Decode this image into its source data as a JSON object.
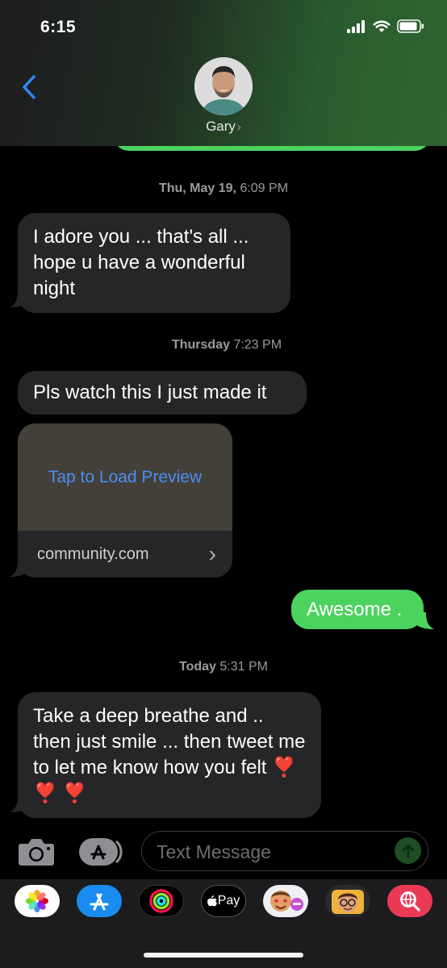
{
  "status": {
    "time": "6:15"
  },
  "header": {
    "contact_name": "Gary",
    "contact_chevron": "›"
  },
  "messages": [
    {
      "timestamp_day": "Thu, May 19,",
      "timestamp_time": "6:09 PM"
    },
    {
      "text": "I adore you ... that's all ... hope u have a wonderful night"
    },
    {
      "timestamp_day": "Thursday",
      "timestamp_time": "7:23 PM"
    },
    {
      "text": "Pls watch this I just made it"
    },
    {
      "preview_action": "Tap to Load Preview",
      "preview_domain": "community.com",
      "preview_chevron": "›"
    },
    {
      "text": "Awesome ."
    },
    {
      "timestamp_day": "Today",
      "timestamp_time": "5:31 PM"
    },
    {
      "text": "Take a deep breathe and .. then just smile ... then tweet me to let me know how you felt ❣️ ❣️ ❣️"
    }
  ],
  "composer": {
    "placeholder": "Text Message"
  },
  "app_strip": {
    "items": [
      "photos-icon",
      "app-store-icon",
      "activity-icon",
      "apple-pay-icon",
      "memoji-stickers-icon",
      "memoji-icon",
      "search-images-icon"
    ],
    "apple_pay_label": "Pay"
  },
  "colors": {
    "sent_bubble": "#4cd35e",
    "received_bubble": "#262628",
    "link": "#4a8ef5"
  }
}
